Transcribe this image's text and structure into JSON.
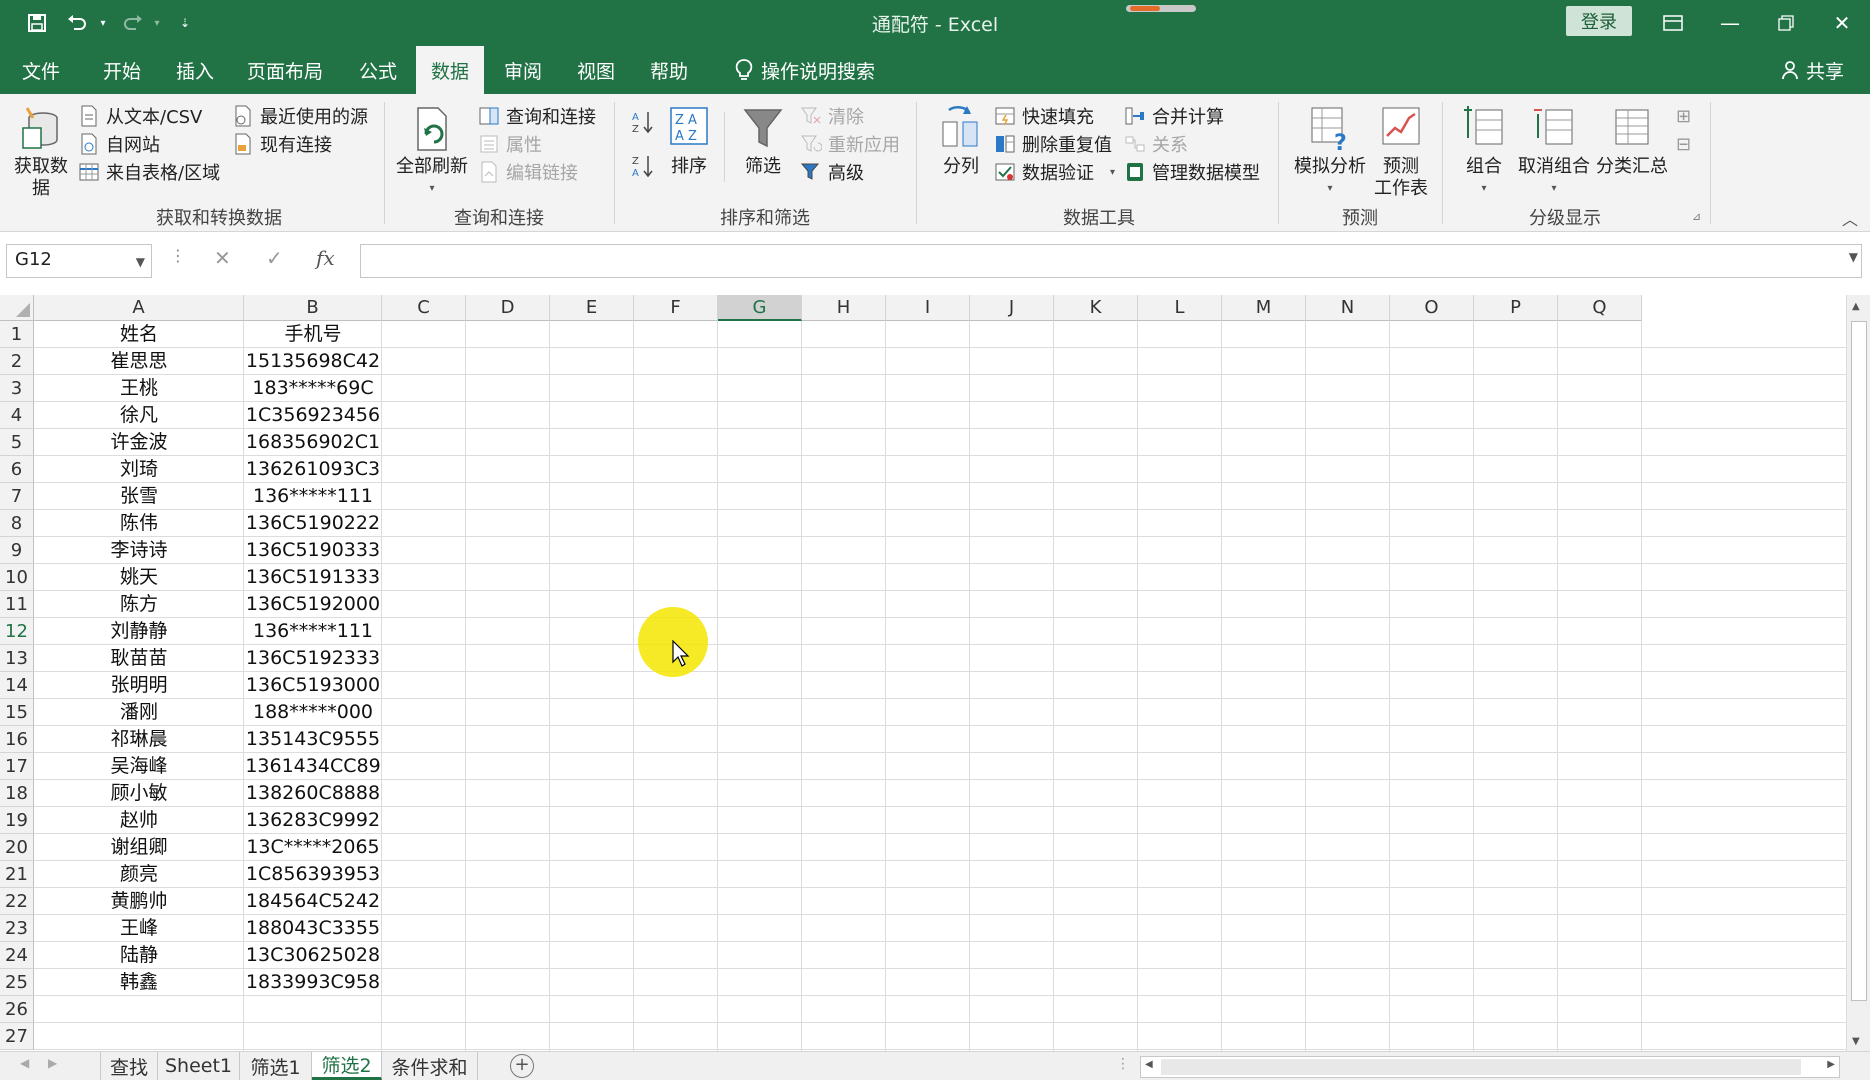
{
  "title": "通配符  -  Excel",
  "login_label": "登录",
  "share_label": "共享",
  "menu_tabs": [
    "文件",
    "开始",
    "插入",
    "页面布局",
    "公式",
    "数据",
    "审阅",
    "视图",
    "帮助"
  ],
  "active_tab": "数据",
  "tell_me": "操作说明搜索",
  "ribbon": {
    "get_data": "获取数\n据",
    "from_text": "从文本/CSV",
    "from_web": "自网站",
    "from_table": "来自表格/区域",
    "recent_sources": "最近使用的源",
    "existing_conn": "现有连接",
    "group_get": "获取和转换数据",
    "refresh_all": "全部刷新",
    "queries_conn": "查询和连接",
    "properties": "属性",
    "edit_links": "编辑链接",
    "group_queries": "查询和连接",
    "sort": "排序",
    "filter": "筛选",
    "clear": "清除",
    "reapply": "重新应用",
    "advanced": "高级",
    "group_sort": "排序和筛选",
    "text_to_columns": "分列",
    "flash_fill": "快速填充",
    "remove_dup": "删除重复值",
    "data_validation": "数据验证",
    "consolidate": "合并计算",
    "relationships": "关系",
    "manage_model": "管理数据模型",
    "group_tools": "数据工具",
    "what_if": "模拟分析",
    "forecast_sheet": "预测\n工作表",
    "group_forecast": "预测",
    "group_btn": "组合",
    "ungroup_btn": "取消组合",
    "subtotal": "分类汇总",
    "group_outline": "分级显示"
  },
  "name_box": "G12",
  "columns": [
    "A",
    "B",
    "C",
    "D",
    "E",
    "F",
    "G",
    "H",
    "I",
    "J",
    "K",
    "L",
    "M",
    "N",
    "O",
    "P",
    "Q"
  ],
  "selected_column": "G",
  "selected_row": 12,
  "rows": [
    [
      "姓名",
      "手机号"
    ],
    [
      "崔思思",
      "15135698C42"
    ],
    [
      "王桃",
      "183*****69C"
    ],
    [
      "徐凡",
      "1C356923456"
    ],
    [
      "许金波",
      "168356902C1"
    ],
    [
      "刘琦",
      "136261093C3"
    ],
    [
      "张雪",
      "136*****111"
    ],
    [
      "陈伟",
      "136C5190222"
    ],
    [
      "李诗诗",
      "136C5190333"
    ],
    [
      "姚天",
      "136C5191333"
    ],
    [
      "陈方",
      "136C5192000"
    ],
    [
      "刘静静",
      "136*****111"
    ],
    [
      "耿苗苗",
      "136C5192333"
    ],
    [
      "张明明",
      "136C5193000"
    ],
    [
      "潘刚",
      "188*****000"
    ],
    [
      "祁琳晨",
      "135143C9555"
    ],
    [
      "吴海峰",
      "1361434CC89"
    ],
    [
      "顾小敏",
      "138260C8888"
    ],
    [
      "赵帅",
      "136283C9992"
    ],
    [
      "谢组卿",
      "13C*****2065"
    ],
    [
      "颜亮",
      "1C856393953"
    ],
    [
      "黄鹏帅",
      "184564C5242"
    ],
    [
      "王峰",
      "188043C3355"
    ],
    [
      "陆静",
      "13C30625028"
    ],
    [
      "韩鑫",
      "1833993C958"
    ],
    [
      "",
      ""
    ],
    [
      "",
      ""
    ]
  ],
  "sheet_tabs": [
    "查找",
    "Sheet1",
    "筛选1",
    "筛选2",
    "条件求和"
  ],
  "active_sheet": "筛选2",
  "colors": {
    "brand": "#217346",
    "cursor_highlight": "#f5e600"
  }
}
